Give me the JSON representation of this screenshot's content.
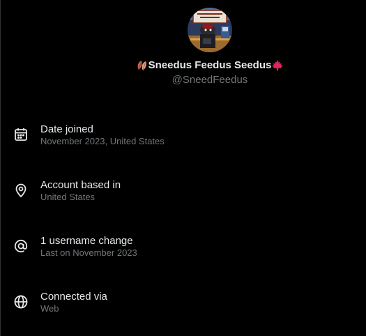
{
  "profile": {
    "display_name": "Sneedus Feedus Seedus",
    "handle": "@SneedFeedus",
    "avatar_sign_text": "Sneed's Feed & Seed"
  },
  "about": [
    {
      "icon": "calendar-icon",
      "title": "Date joined",
      "subtitle": "November 2023, United States"
    },
    {
      "icon": "location-pin-icon",
      "title": "Account based in",
      "subtitle": "United States"
    },
    {
      "icon": "at-sign-icon",
      "title": "1 username change",
      "subtitle": "Last on November 2023"
    },
    {
      "icon": "globe-icon",
      "title": "Connected via",
      "subtitle": "Web"
    }
  ],
  "colors": {
    "background": "#000000",
    "primary_text": "#e7e9ea",
    "secondary_text": "#71767b",
    "maple_leaf": "#e0245e",
    "fall_leaves": "#c1694f"
  }
}
